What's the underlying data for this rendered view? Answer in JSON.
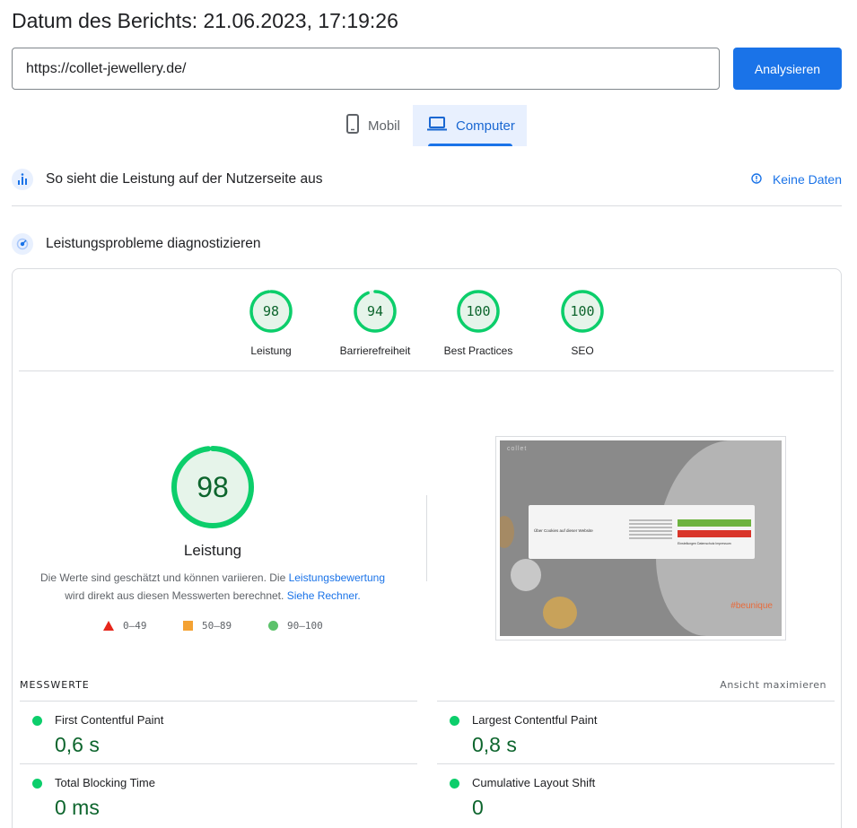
{
  "report": {
    "title": "Datum des Berichts: 21.06.2023, 17:19:26"
  },
  "search": {
    "url_value": "https://collet-jewellery.de/",
    "analyze_label": "Analysieren"
  },
  "device_tabs": {
    "mobile": "Mobil",
    "desktop": "Computer",
    "selected": "Computer"
  },
  "field_data": {
    "title": "So sieht die Leistung auf der Nutzerseite aus",
    "no_data": "Keine Daten"
  },
  "lab_data": {
    "title": "Leistungsprobleme diagnostizieren"
  },
  "scores": [
    {
      "label": "Leistung",
      "value": "98"
    },
    {
      "label": "Barrierefreiheit",
      "value": "94"
    },
    {
      "label": "Best Practices",
      "value": "100"
    },
    {
      "label": "SEO",
      "value": "100"
    }
  ],
  "performance": {
    "score": "98",
    "title": "Leistung",
    "desc_part1": "Die Werte sind geschätzt und können variieren. Die ",
    "desc_link1": "Leistungsbewertung",
    "desc_part2": "wird direkt aus diesen Messwerten berechnet. ",
    "desc_link2": "Siehe Rechner."
  },
  "legend": {
    "low": "0–49",
    "mid": "50–89",
    "high": "90–100"
  },
  "screenshot": {
    "logo": "collet",
    "dialog_title": "Über Cookies auf dieser Website",
    "btn_accept": "Alle akzeptieren",
    "btn_required": "Notwendige Cookies akzeptieren",
    "links": "Einstellungen   Datenschutz   Impressum",
    "brand": "#beunique"
  },
  "metrics": {
    "header": "MESSWERTE",
    "maximize": "Ansicht maximieren",
    "items": [
      {
        "label": "First Contentful Paint",
        "value": "0,6 s"
      },
      {
        "label": "Largest Contentful Paint",
        "value": "0,8 s"
      },
      {
        "label": "Total Blocking Time",
        "value": "0 ms"
      },
      {
        "label": "Cumulative Layout Shift",
        "value": "0"
      }
    ]
  },
  "colors": {
    "accent": "#1a73e8",
    "good": "#0cce6b",
    "good_text": "#0d652d",
    "average": "#f4a233",
    "poor": "#e6261b"
  }
}
